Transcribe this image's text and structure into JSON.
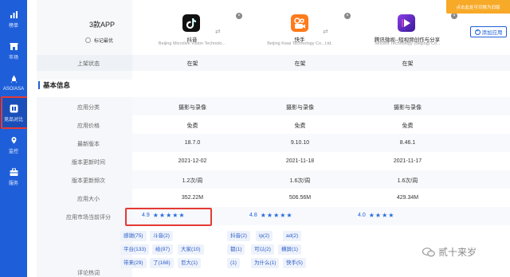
{
  "sidebar": {
    "items": [
      {
        "label": "榜单",
        "icon": "bar-chart-icon"
      },
      {
        "label": "市场",
        "icon": "store-icon"
      },
      {
        "label": "ASO/ASA",
        "icon": "rocket-icon"
      },
      {
        "label": "竞品对比",
        "icon": "compare-icon"
      },
      {
        "label": "监控",
        "icon": "monitor-icon"
      },
      {
        "label": "服务",
        "icon": "briefcase-icon"
      }
    ],
    "active_index": 3
  },
  "toast": "点击此处可切换为旧版",
  "header": {
    "app_count": "3款APP",
    "mark_best": "标记最优",
    "add_button": "添加应用"
  },
  "apps": [
    {
      "name": "抖音",
      "company": "Beijing Microlive Vision Technolo...",
      "icon": "tiktok-icon",
      "color": "#111111"
    },
    {
      "name": "快手",
      "company": "Beijing Kwai Technology Co., Ltd.",
      "icon": "kuaishou-icon",
      "color": "#ff7a1a"
    },
    {
      "name": "腾讯微视--短视频创作与分享",
      "company": "Tencent Technology (Beijing) Co...",
      "icon": "weishi-icon",
      "color": "#6a2ccf"
    }
  ],
  "listing_status": {
    "label": "上架状态",
    "values": [
      "在架",
      "在架",
      "在架"
    ]
  },
  "section": {
    "title": "基本信息"
  },
  "rows": [
    {
      "label": "应用分类",
      "values": [
        "摄影与录像",
        "摄影与录像",
        "摄影与录像"
      ]
    },
    {
      "label": "应用价格",
      "values": [
        "免费",
        "免费",
        "免费"
      ]
    },
    {
      "label": "最新版本",
      "values": [
        "18.7.0",
        "9.10.10",
        "8.46.1"
      ]
    },
    {
      "label": "版本更新时间",
      "values": [
        "2021-12-02",
        "2021-11-18",
        "2021-11-17"
      ]
    },
    {
      "label": "版本更新频次",
      "values": [
        "1.2次/周",
        "1.6次/周",
        "1.6次/周"
      ]
    },
    {
      "label": "应用大小",
      "values": [
        "352.22M",
        "506.56M",
        "429.34M"
      ]
    }
  ],
  "rating_row": {
    "label": "应用市场当前评分",
    "values": [
      {
        "score": "4.9",
        "stars": 5
      },
      {
        "score": "4.8",
        "stars": 5
      },
      {
        "score": "4.0",
        "stars": 4
      }
    ]
  },
  "hot_words_label": "评论热词",
  "tags": {
    "col1": [
      "感谢(75)",
      "斗音(2)",
      "平台(133)",
      "给(97)",
      "大家(10)",
      "带来(29)",
      "了(168)",
      "巨大(1)"
    ],
    "col2": [
      "抖音(2)",
      "ip(2)",
      "ad(2)",
      "都(1)",
      "可以(2)",
      "横屏(1)",
      "(1)",
      "为什么(1)",
      "快手(5)"
    ]
  },
  "watermark": "贰十来岁"
}
